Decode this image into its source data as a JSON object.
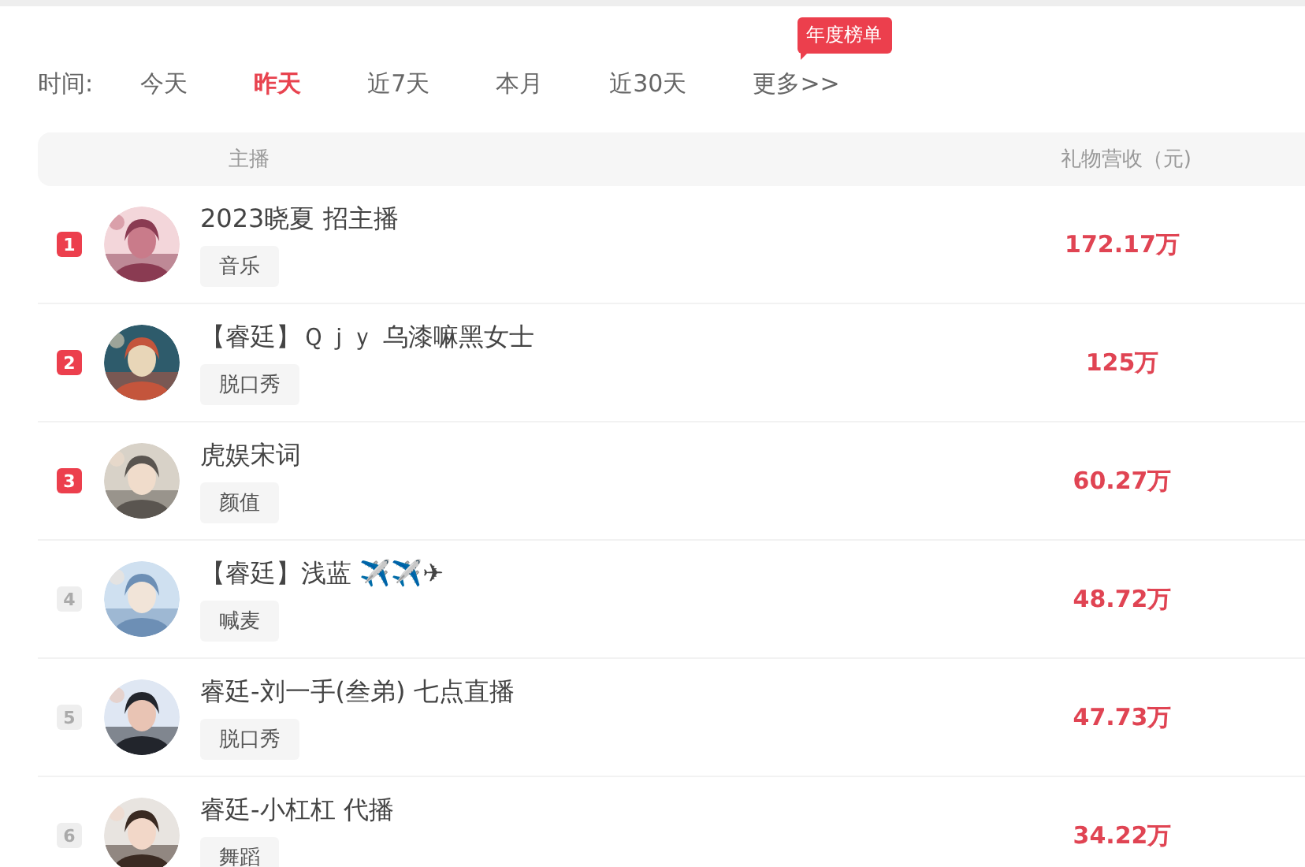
{
  "time_filter": {
    "label": "时间:",
    "options": [
      {
        "label": "今天",
        "selected": false
      },
      {
        "label": "昨天",
        "selected": true
      },
      {
        "label": "近7天",
        "selected": false
      },
      {
        "label": "本月",
        "selected": false
      },
      {
        "label": "近30天",
        "selected": false
      },
      {
        "label": "更多>>",
        "selected": false
      }
    ],
    "badge": "年度榜单"
  },
  "table": {
    "columns": [
      "主播",
      "礼物营收（元)"
    ],
    "rows": [
      {
        "rank": "1",
        "highlighted": true,
        "name": "2023晓夏 招主播",
        "tag": "音乐",
        "revenue": "172.17万"
      },
      {
        "rank": "2",
        "highlighted": true,
        "name": "【睿廷】Ｑｊｙ 乌漆嘛黑女士",
        "tag": "脱口秀",
        "revenue": "125万"
      },
      {
        "rank": "3",
        "highlighted": true,
        "name": "虎娱宋词",
        "tag": "颜值",
        "revenue": "60.27万"
      },
      {
        "rank": "4",
        "highlighted": false,
        "name": "【睿廷】浅蓝 ✈️✈️✈",
        "tag": "喊麦",
        "revenue": "48.72万"
      },
      {
        "rank": "5",
        "highlighted": false,
        "name": "睿廷-刘一手(叁弟) 七点直播",
        "tag": "脱口秀",
        "revenue": "47.73万"
      },
      {
        "rank": "6",
        "highlighted": false,
        "name": "睿廷-小杠杠 代播",
        "tag": "舞蹈",
        "revenue": "34.22万"
      }
    ]
  }
}
